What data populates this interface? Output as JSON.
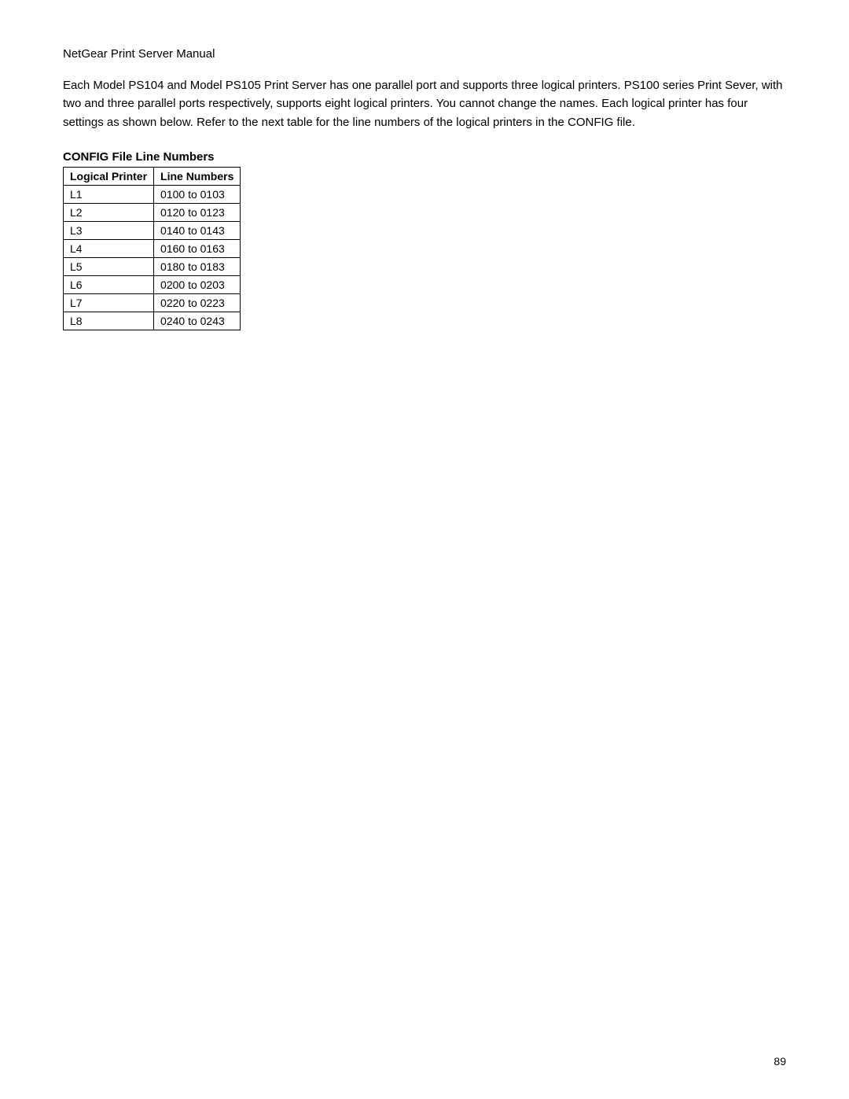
{
  "header": {
    "title": "NetGear Print Server Manual"
  },
  "body": {
    "paragraph": "Each Model PS104 and Model PS105 Print Server has one parallel port and supports three logical printers. PS100 series Print Sever, with two and three parallel ports respectively, supports eight logical printers. You cannot change the names. Each logical printer has four settings as shown below. Refer to the next table for the line numbers of the logical printers in the CONFIG file."
  },
  "section": {
    "heading": "CONFIG File Line Numbers"
  },
  "table": {
    "columns": [
      {
        "label": "Logical Printer"
      },
      {
        "label": "Line Numbers"
      }
    ],
    "rows": [
      {
        "printer": "L1",
        "lines": "0100 to 0103"
      },
      {
        "printer": "L2",
        "lines": "0120 to 0123"
      },
      {
        "printer": "L3",
        "lines": "0140 to 0143"
      },
      {
        "printer": "L4",
        "lines": "0160 to 0163"
      },
      {
        "printer": "L5",
        "lines": "0180 to 0183"
      },
      {
        "printer": "L6",
        "lines": "0200 to 0203"
      },
      {
        "printer": "L7",
        "lines": "0220 to 0223"
      },
      {
        "printer": "L8",
        "lines": "0240 to 0243"
      }
    ]
  },
  "footer": {
    "page_number": "89"
  }
}
